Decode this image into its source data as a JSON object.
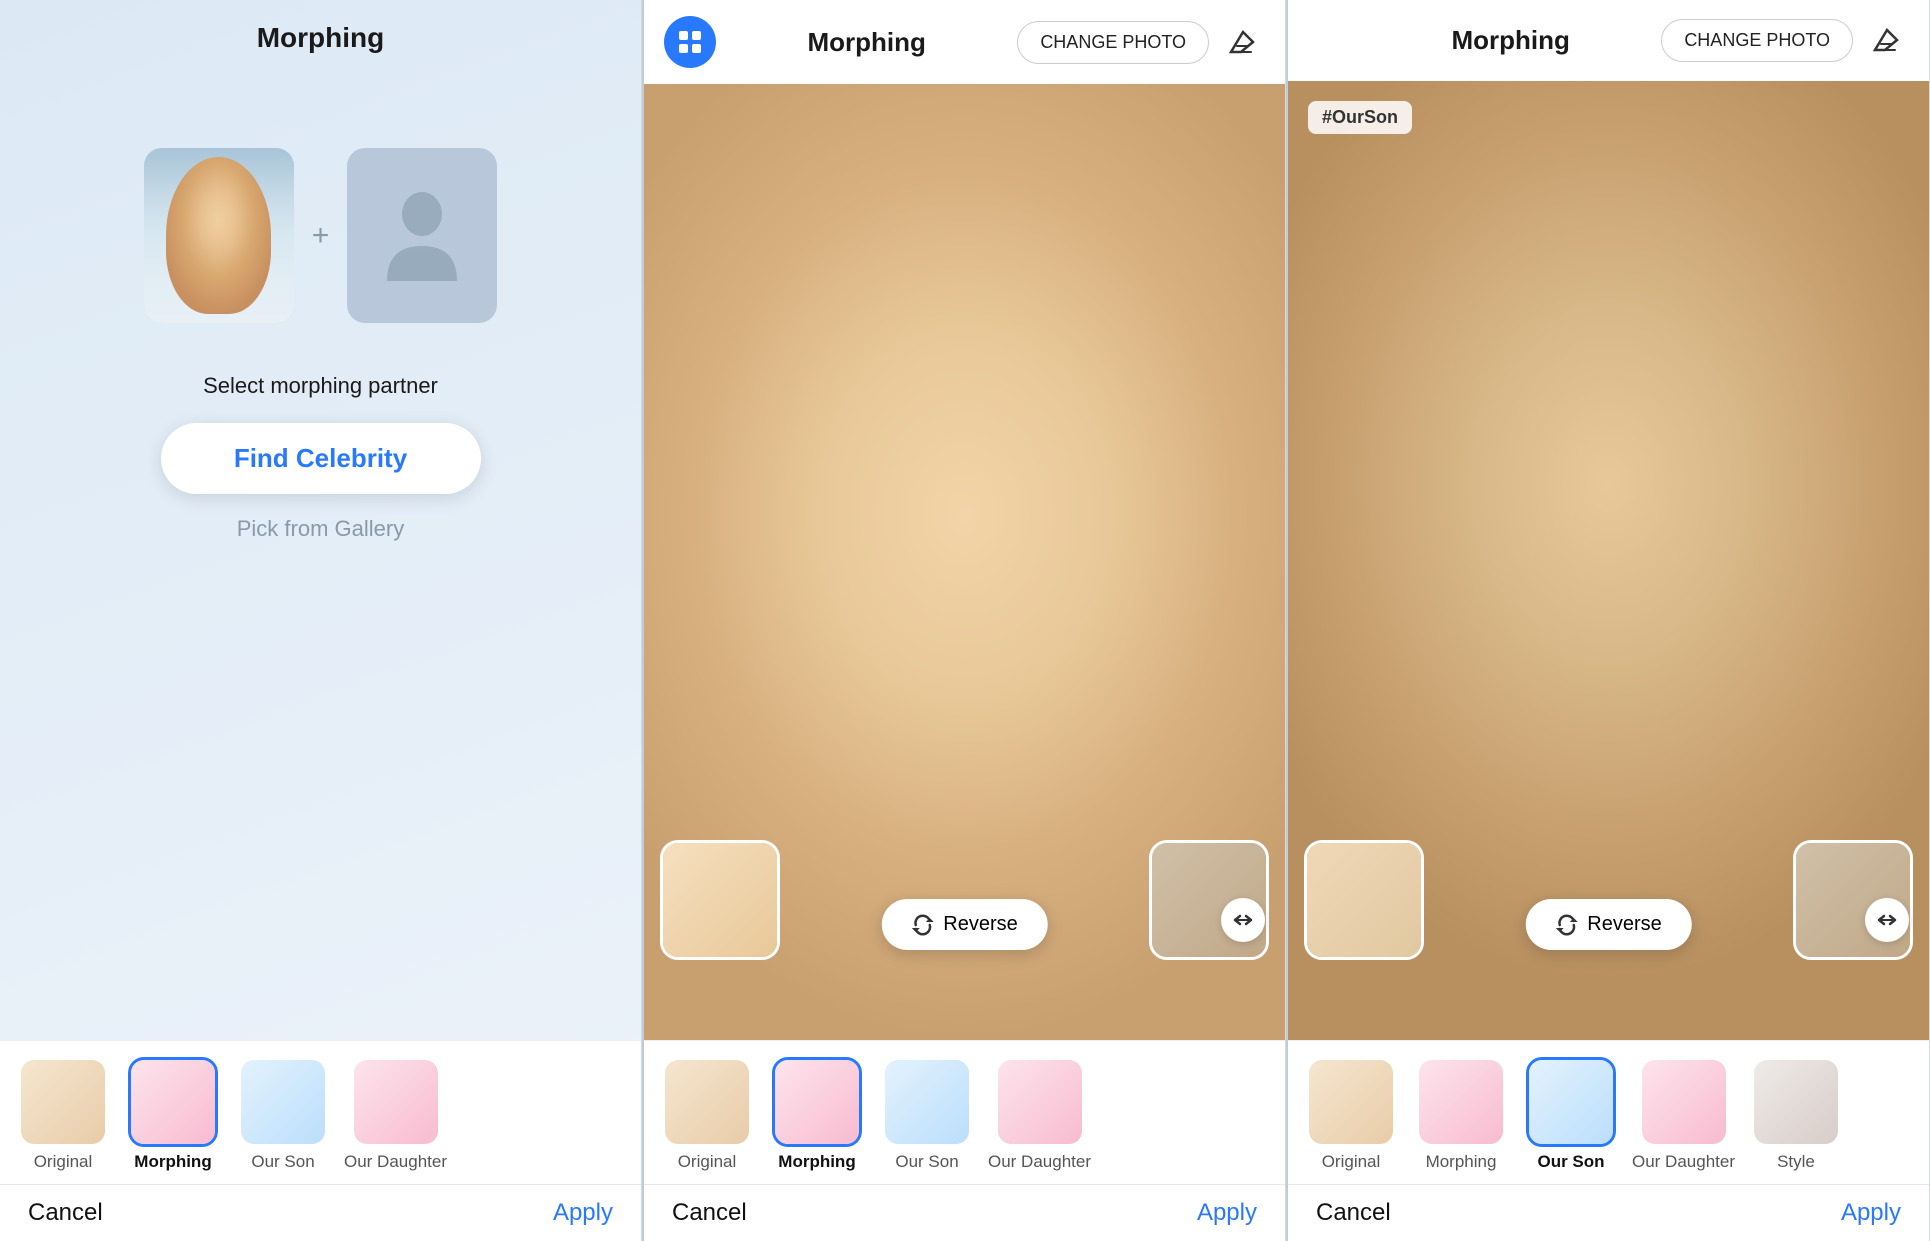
{
  "panel1": {
    "title": "Morphing",
    "select_label": "Select morphing partner",
    "find_celebrity_btn": "Find Celebrity",
    "pick_gallery_btn": "Pick from Gallery",
    "cancel_btn": "Cancel",
    "apply_btn": "Apply"
  },
  "panel2": {
    "title": "Morphing",
    "change_photo_btn": "CHANGE PHOTO",
    "reverse_btn": "Reverse",
    "cancel_btn": "Cancel",
    "apply_btn": "Apply",
    "tabs": [
      {
        "id": "original",
        "label": "Original",
        "selected": false
      },
      {
        "id": "morphing",
        "label": "Morphing",
        "selected": true
      },
      {
        "id": "our-son",
        "label": "Our Son",
        "selected": false
      },
      {
        "id": "our-daughter",
        "label": "Our Daughter",
        "selected": false
      }
    ]
  },
  "panel3": {
    "title": "Morphing",
    "change_photo_btn": "CHANGE PHOTO",
    "hashtag": "#OurSon",
    "reverse_btn": "Reverse",
    "cancel_btn": "Cancel",
    "apply_btn": "Apply",
    "tabs": [
      {
        "id": "original",
        "label": "Original",
        "selected": false
      },
      {
        "id": "morphing",
        "label": "Morphing",
        "selected": false
      },
      {
        "id": "our-son",
        "label": "Our Son",
        "selected": true
      },
      {
        "id": "our-daughter",
        "label": "Our Daughter",
        "selected": false
      },
      {
        "id": "style",
        "label": "Style",
        "selected": false
      }
    ]
  },
  "icons": {
    "grid": "⊞",
    "eraser": "◈",
    "reverse": "↺",
    "expand": "↔"
  }
}
